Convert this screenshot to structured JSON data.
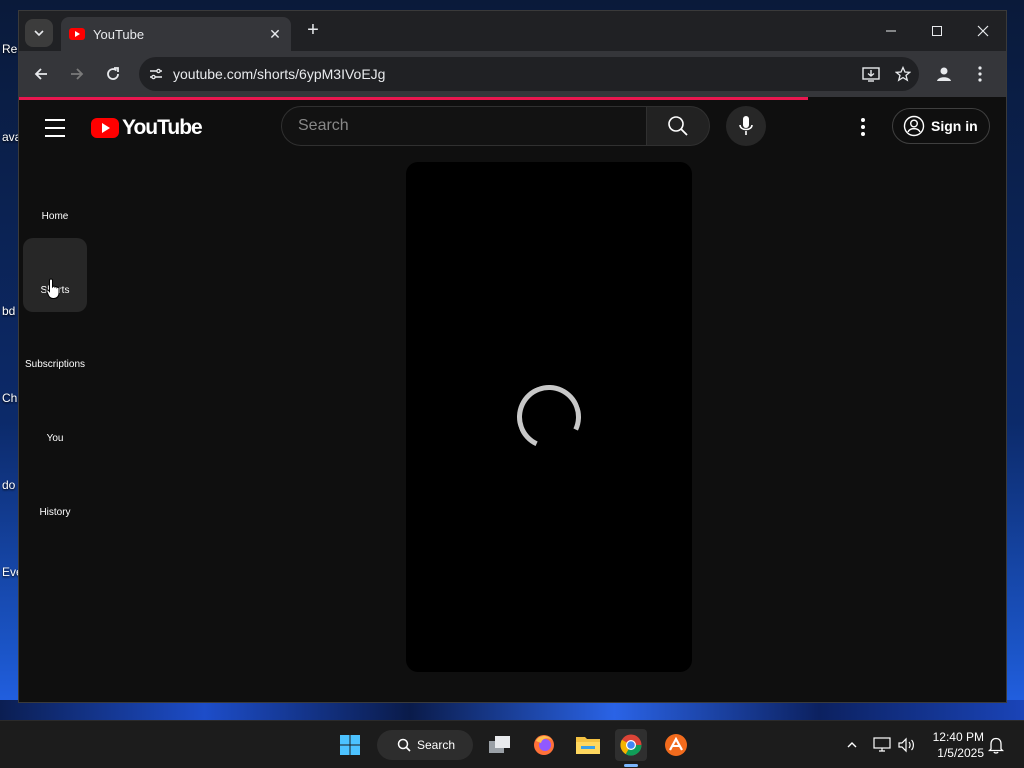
{
  "browser": {
    "tab_title": "YouTube",
    "url": "youtube.com/shorts/6ypM3IVoEJg",
    "icons": [
      "tab-search-icon",
      "tab-close-icon",
      "new-tab-icon",
      "minimize-icon",
      "maximize-icon",
      "close-icon",
      "back-icon",
      "forward-icon",
      "reload-icon",
      "site-info-icon",
      "install-app-icon",
      "bookmark-star-icon",
      "profile-icon",
      "kebab-menu-icon"
    ],
    "loading": true
  },
  "youtube": {
    "logo_text": "YouTube",
    "search_placeholder": "Search",
    "signin_label": "Sign in",
    "guide": [
      {
        "label": "Home",
        "active": false
      },
      {
        "label": "Shorts",
        "active": true
      },
      {
        "label": "Subscriptions",
        "active": false
      },
      {
        "label": "You",
        "active": false
      },
      {
        "label": "History",
        "active": false
      }
    ],
    "accent_color": "#ff0000"
  },
  "desktop": {
    "labels": [
      "Re",
      "ava",
      "bd",
      "Ch",
      "do",
      "Eve"
    ]
  },
  "taskbar": {
    "search_label": "Search",
    "time": "12:40 PM",
    "date": "1/5/2025",
    "apps": [
      "windows-start-icon",
      "task-view-icon",
      "firefox-icon",
      "file-explorer-icon",
      "chrome-icon",
      "app-icon"
    ]
  }
}
